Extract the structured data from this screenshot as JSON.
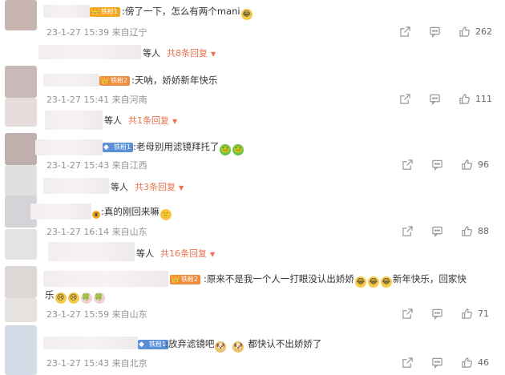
{
  "comments": [
    {
      "text": ":傍了一下，怎么有两个mani",
      "badge": "铁粉1",
      "badge_color": "#f5a623",
      "time": "23-1-27 15:39",
      "location": "来自辽宁",
      "likes": "262",
      "replies": {
        "who": "等人",
        "link": "共8条回复"
      }
    },
    {
      "text": ":天呐，娇娇新年快乐",
      "badge": "铁粉2",
      "badge_color": "#f08b3c",
      "time": "23-1-27 15:41",
      "location": "来自河南",
      "likes": "111",
      "replies": {
        "who": "等人",
        "link": "共1条回复"
      }
    },
    {
      "text": ":老母别用滤镜拜托了",
      "badge": "铁粉1",
      "badge_color": "#5b8fd8",
      "time": "23-1-27 15:43",
      "location": "来自江西",
      "likes": "96",
      "replies": {
        "who": "等人",
        "link": "共3条回复"
      }
    },
    {
      "text": ":真的刚回来嘛",
      "time": "23-1-27 16:14",
      "location": "来自山东",
      "likes": "88",
      "replies": {
        "who": "等人",
        "link": "共16条回复"
      }
    },
    {
      "text_line1": ":原来不是我一个人一打眼没认出娇娇",
      "text_line1_tail": "新年快乐，回家快",
      "text_line2": "乐",
      "badge": "铁粉2",
      "badge_color": "#f08b3c",
      "time": "23-1-27 15:59",
      "location": "来自山东",
      "likes": "71"
    },
    {
      "text": ":放弃滤镜吧",
      "text_tail": "都快认不出娇娇了",
      "badge": "铁粉1",
      "badge_color": "#5b8fd8",
      "time": "23-1-27 15:43",
      "location": "来自北京",
      "likes": "46"
    }
  ]
}
